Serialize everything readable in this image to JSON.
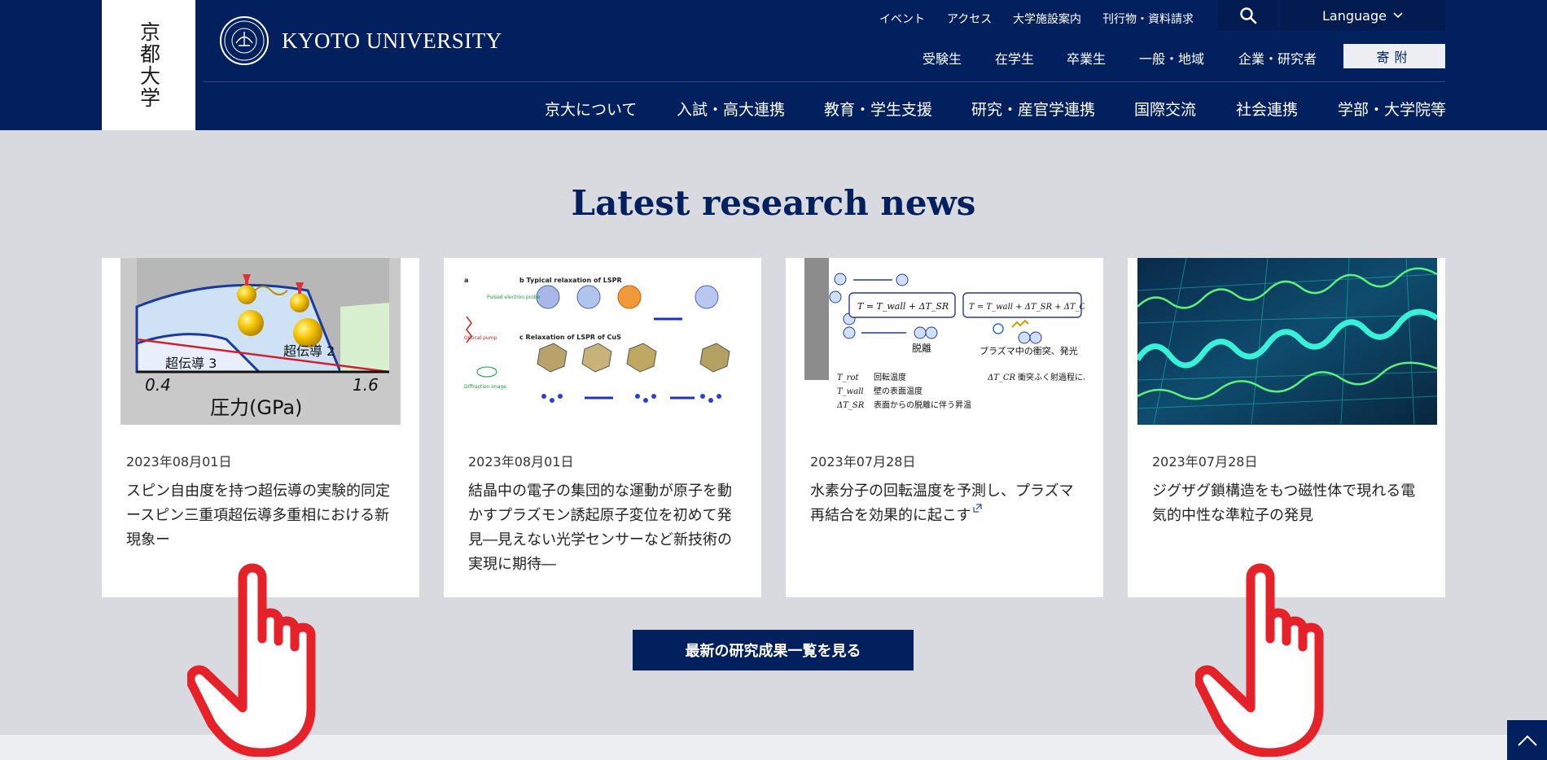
{
  "brand": {
    "vertical_name": "京都大学",
    "name": "KYOTO UNIVERSITY"
  },
  "util_nav": [
    "イベント",
    "アクセス",
    "大学施設案内",
    "刊行物・資料請求"
  ],
  "language": {
    "label": "Language"
  },
  "audience_nav": [
    "受験生",
    "在学生",
    "卒業生",
    "一般・地域",
    "企業・研究者"
  ],
  "donate_label": "寄附",
  "main_nav": [
    "京大について",
    "入試・高大連携",
    "教育・学生支援",
    "研究・産官学連携",
    "国際交流",
    "社会連携",
    "学部・大学院等"
  ],
  "section": {
    "title": "Latest research news"
  },
  "cards": [
    {
      "date": "2023年08月01日",
      "title": "スピン自由度を持つ超伝導の実験的同定ースピン三重項超伝導多重相における新現象ー",
      "external": false
    },
    {
      "date": "2023年08月01日",
      "title": "結晶中の電子の集団的な運動が原子を動かすプラズモン誘起原子変位を初めて発見―見えない光学センサーなど新技術の実現に期待―",
      "external": false
    },
    {
      "date": "2023年07月28日",
      "title": "水素分子の回転温度を予測し、プラズマ再結合を効果的に起こす",
      "external": true
    },
    {
      "date": "2023年07月28日",
      "title": "ジグザグ鎖構造をもつ磁性体で現れる電気的中性な準粒子の発見",
      "external": false
    }
  ],
  "card1_figure": {
    "phase_labels": [
      "超伝導 2",
      "超伝導 3"
    ],
    "axis_ticks": [
      "0.4",
      "1.6"
    ],
    "axis_label": "圧力(GPa)"
  },
  "card2_figure": {
    "panel_labels": [
      "a",
      "b  Typical relaxation of LSPR",
      "c  Relaxation of LSPR of CuS"
    ],
    "side_labels": [
      "Pulsed electron probe",
      "Optical pump",
      "Diffraction image"
    ]
  },
  "card3_figure": {
    "labels": [
      "脱離",
      "プラズマ中の衝突、発光",
      "回転温度",
      "壁の表面温度",
      "表面からの脱離に伴う昇温",
      "衝突ふく射過程による昇温"
    ]
  },
  "cta_label": "最新の研究成果一覧を見る",
  "colors": {
    "primary": "#03205e",
    "background": "#d8dadf",
    "hand": "#e52229"
  }
}
